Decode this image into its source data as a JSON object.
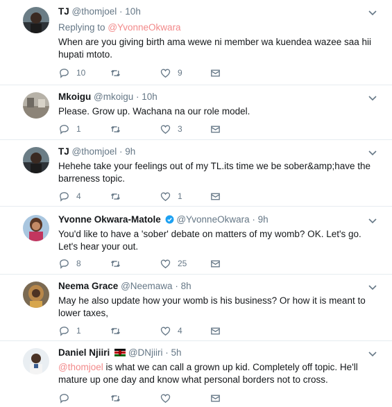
{
  "tweets": [
    {
      "name": "TJ",
      "handle": "@thomjoel",
      "time": "10h",
      "reply_prefix": "Replying to",
      "reply_to": "@YvonneOkwara",
      "text": "When are you giving birth ama wewe ni member wa kuendea wazee saa hii hupati mtoto.",
      "replies": "10",
      "retweets": "",
      "likes": "9"
    },
    {
      "name": "Mkoigu",
      "handle": "@mkoigu",
      "time": "10h",
      "text": "Please. Grow up. Wachana na our role model.",
      "replies": "1",
      "retweets": "",
      "likes": "3"
    },
    {
      "name": "TJ",
      "handle": "@thomjoel",
      "time": "9h",
      "text": "Hehehe take your feelings out of my TL.its time we be sober&amp;have the barreness topic.",
      "replies": "4",
      "retweets": "",
      "likes": "1"
    },
    {
      "name": "Yvonne Okwara-Matole",
      "handle": "@YvonneOkwara",
      "time": "9h",
      "text": "You'd like to have a 'sober' debate on matters of my womb?  OK.  Let's go. Let's hear your out.",
      "replies": "8",
      "retweets": "",
      "likes": "25"
    },
    {
      "name": "Neema Grace",
      "handle": "@Neemawa",
      "time": "8h",
      "text": "May he also update how your womb is his business? Or how it is meant to lower taxes,",
      "replies": "1",
      "retweets": "",
      "likes": "4"
    },
    {
      "name": "Daniel Njiiri",
      "handle": "@DNjiiri",
      "time": "5h",
      "text_mention": "@thomjoel",
      "text": " is what we can call a grown up kid. Completely off topic. He'll mature up one day and know what personal borders not to cross.",
      "replies": "",
      "retweets": "",
      "likes": ""
    }
  ],
  "separator": "·",
  "colors": {
    "accent": "#1da1f2",
    "mention": "#f2898a",
    "muted": "#657786",
    "text": "#14171a"
  }
}
